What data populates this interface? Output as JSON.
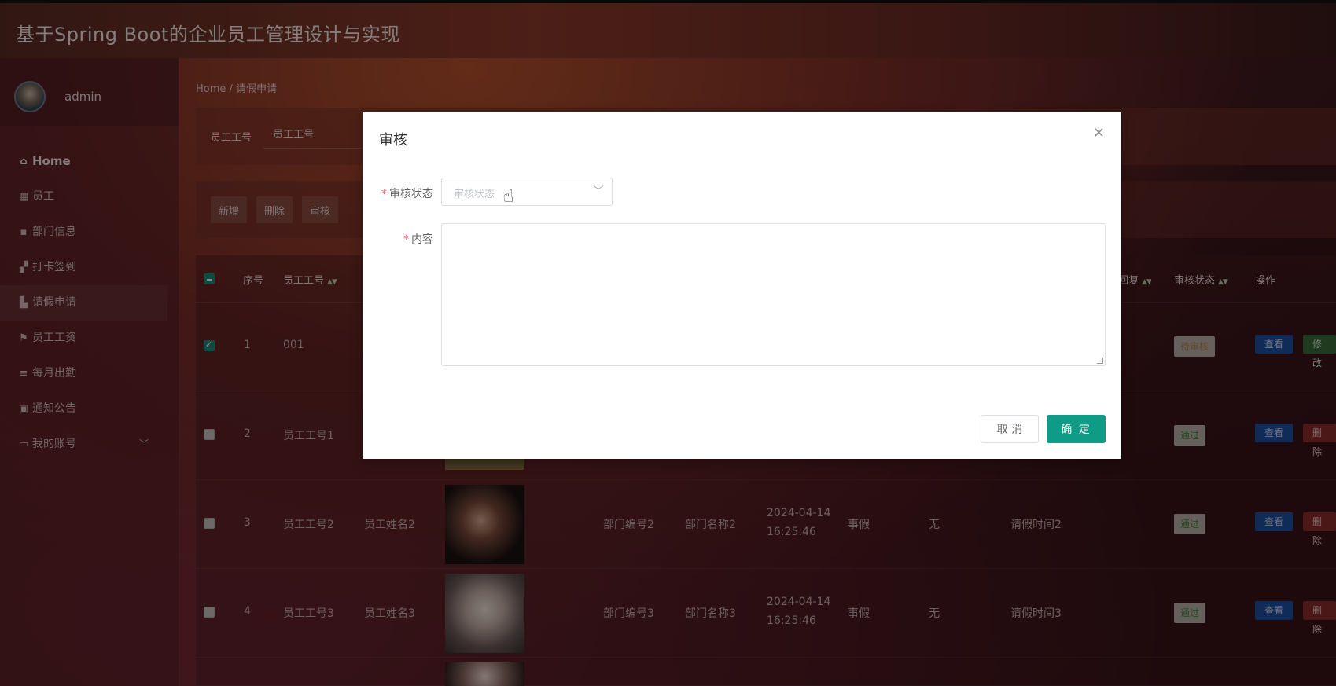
{
  "app": {
    "title": "基于Spring Boot的企业员工管理设计与实现"
  },
  "user": {
    "name": "admin"
  },
  "sidebar": {
    "items": [
      {
        "label": "Home",
        "icon": "home-icon",
        "glyph": "⌂"
      },
      {
        "label": "员工",
        "icon": "grid-icon",
        "glyph": "▦"
      },
      {
        "label": "部门信息",
        "icon": "comment-icon",
        "glyph": "▪"
      },
      {
        "label": "打卡签到",
        "icon": "apps-icon",
        "glyph": "▞"
      },
      {
        "label": "请假申请",
        "icon": "chart-icon",
        "glyph": "▙"
      },
      {
        "label": "员工工资",
        "icon": "flag-icon",
        "glyph": "⚑"
      },
      {
        "label": "每月出勤",
        "icon": "sliders-icon",
        "glyph": "≡"
      },
      {
        "label": "通知公告",
        "icon": "clipboard-icon",
        "glyph": "▣"
      },
      {
        "label": "我的账号",
        "icon": "credit-card-icon",
        "glyph": "▭"
      }
    ]
  },
  "breadcrumb": "Home / 请假申请",
  "search": {
    "label": "员工工号",
    "placeholder": "员工工号"
  },
  "toolbar": {
    "add": "新增",
    "delete": "删除",
    "audit": "审核"
  },
  "table": {
    "headers": {
      "index": "序号",
      "emp_no": "员工工号",
      "reply": "回复",
      "status": "审核状态",
      "action": "操作"
    },
    "rows": [
      {
        "index": "1",
        "emp_no": "001",
        "status": "待审核",
        "status_type": "pending",
        "checked": true
      },
      {
        "index": "2",
        "emp_no": "员工工号1",
        "status": "通过",
        "status_type": "pass",
        "checked": false
      },
      {
        "index": "3",
        "emp_no": "员工工号2",
        "name": "员工姓名2",
        "dept_no": "部门编号2",
        "dept_name": "部门名称2",
        "date": "2024-04-14",
        "time": "16:25:46",
        "type": "事假",
        "reply_val": "无",
        "leave_time": "请假时间2",
        "status": "通过",
        "status_type": "pass",
        "checked": false
      },
      {
        "index": "4",
        "emp_no": "员工工号3",
        "name": "员工姓名3",
        "dept_no": "部门编号3",
        "dept_name": "部门名称3",
        "date": "2024-04-14",
        "time": "16:25:46",
        "type": "事假",
        "reply_val": "无",
        "leave_time": "请假时间3",
        "status": "通过",
        "status_type": "pass",
        "checked": false
      }
    ],
    "actions": {
      "view": "查看",
      "edit": "修改",
      "delete": "删除"
    }
  },
  "dialog": {
    "title": "审核",
    "status_label": "审核状态",
    "status_placeholder": "审核状态",
    "content_label": "内容",
    "cancel": "取 消",
    "confirm": "确 定"
  }
}
